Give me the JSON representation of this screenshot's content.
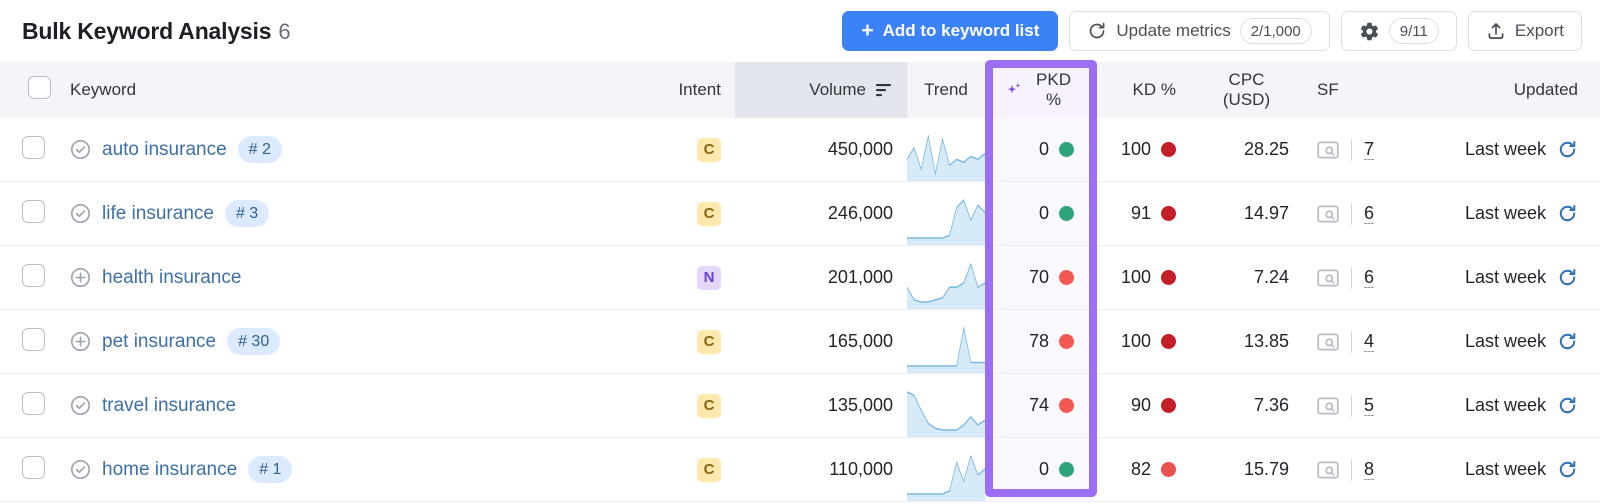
{
  "header": {
    "title": "Bulk Keyword Analysis",
    "count": "6",
    "add_to_list_label": "Add to keyword list",
    "add_icon": "plus-icon",
    "update_metrics_label": "Update metrics",
    "update_metrics_badge": "2/1,000",
    "update_icon": "refresh-icon",
    "settings_icon": "gear-icon",
    "settings_badge": "9/11",
    "export_label": "Export",
    "export_icon": "upload-icon"
  },
  "colors": {
    "primary": "#3b82f6",
    "highlight_border": "#9b6ef3",
    "highlight_bg": "#faf7fe",
    "sorted_header_bg": "#e3e5ec",
    "header_bg": "#f4f5f9",
    "dot_green": "#2fa37a",
    "dot_red_light": "#f2584f",
    "dot_red_dark": "#c21f28",
    "dot_red_mid": "#e9514f",
    "spark_line": "#7ab8e0",
    "spark_fill": "#d6eaf8",
    "link": "#3d6fa8"
  },
  "table": {
    "select_all_checkbox": "unchecked",
    "columns": [
      {
        "key": "keyword",
        "label": "Keyword",
        "align": "left"
      },
      {
        "key": "intent",
        "label": "Intent",
        "align": "right"
      },
      {
        "key": "volume",
        "label": "Volume",
        "align": "right",
        "sorted": true,
        "sort_icon": "sort-descending-icon"
      },
      {
        "key": "trend",
        "label": "Trend",
        "align": "center"
      },
      {
        "key": "pkd",
        "label": "PKD %",
        "align": "right",
        "icon": "sparkle-ai-icon",
        "highlighted": true
      },
      {
        "key": "kd",
        "label": "KD %",
        "align": "right"
      },
      {
        "key": "cpc",
        "label": "CPC (USD)",
        "align": "right"
      },
      {
        "key": "sf",
        "label": "SF",
        "align": "left"
      },
      {
        "key": "updated",
        "label": "Updated",
        "align": "right"
      }
    ],
    "rows": [
      {
        "checkbox": "unchecked",
        "status_icon": "check-circle-icon",
        "keyword": "auto insurance",
        "rank_badge": "# 2",
        "intent": "C",
        "volume": "450,000",
        "trend": [
          62,
          70,
          55,
          78,
          52,
          76,
          58,
          62,
          60,
          64,
          62,
          66
        ],
        "pkd": "0",
        "pkd_dot": "green",
        "kd": "100",
        "kd_dot": "red-dark",
        "cpc": "28.25",
        "sf_icon": "serp-preview-icon",
        "sf": "7",
        "updated": "Last week",
        "update_icon": "refresh-icon"
      },
      {
        "checkbox": "unchecked",
        "status_icon": "check-circle-icon",
        "keyword": "life insurance",
        "rank_badge": "# 3",
        "intent": "C",
        "volume": "246,000",
        "trend": [
          46,
          46,
          46,
          46,
          46,
          46,
          48,
          70,
          76,
          60,
          72,
          66
        ],
        "pkd": "0",
        "pkd_dot": "green",
        "kd": "91",
        "kd_dot": "red-dark",
        "cpc": "14.97",
        "sf_icon": "serp-preview-icon",
        "sf": "6",
        "updated": "Last week",
        "update_icon": "refresh-icon"
      },
      {
        "checkbox": "unchecked",
        "status_icon": "plus-circle-icon",
        "keyword": "health insurance",
        "rank_badge": "",
        "intent": "N",
        "volume": "201,000",
        "trend": [
          62,
          50,
          48,
          48,
          50,
          52,
          62,
          62,
          66,
          84,
          62,
          66
        ],
        "pkd": "70",
        "pkd_dot": "red-light",
        "kd": "100",
        "kd_dot": "red-dark",
        "cpc": "7.24",
        "sf_icon": "serp-preview-icon",
        "sf": "6",
        "updated": "Last week",
        "update_icon": "refresh-icon"
      },
      {
        "checkbox": "unchecked",
        "status_icon": "plus-circle-icon",
        "keyword": "pet insurance",
        "rank_badge": "# 30",
        "intent": "C",
        "volume": "165,000",
        "trend": [
          52,
          52,
          52,
          52,
          52,
          52,
          52,
          52,
          74,
          54,
          54,
          54
        ],
        "pkd": "78",
        "pkd_dot": "red-light",
        "kd": "100",
        "kd_dot": "red-dark",
        "cpc": "13.85",
        "sf_icon": "serp-preview-icon",
        "sf": "4",
        "updated": "Last week",
        "update_icon": "refresh-icon"
      },
      {
        "checkbox": "unchecked",
        "status_icon": "check-circle-icon",
        "keyword": "travel insurance",
        "rank_badge": "",
        "intent": "C",
        "volume": "135,000",
        "trend": [
          84,
          80,
          62,
          46,
          40,
          38,
          38,
          38,
          44,
          54,
          44,
          50
        ],
        "pkd": "74",
        "pkd_dot": "red-light",
        "kd": "90",
        "kd_dot": "red-dark",
        "cpc": "7.36",
        "sf_icon": "serp-preview-icon",
        "sf": "5",
        "updated": "Last week",
        "update_icon": "refresh-icon"
      },
      {
        "checkbox": "unchecked",
        "status_icon": "check-circle-icon",
        "keyword": "home insurance",
        "rank_badge": "# 1",
        "intent": "C",
        "volume": "110,000",
        "trend": [
          50,
          50,
          50,
          50,
          50,
          50,
          52,
          70,
          58,
          74,
          62,
          66
        ],
        "pkd": "0",
        "pkd_dot": "green",
        "kd": "82",
        "kd_dot": "red-mid",
        "cpc": "15.79",
        "sf_icon": "serp-preview-icon",
        "sf": "8",
        "updated": "Last week",
        "update_icon": "refresh-icon"
      }
    ]
  }
}
